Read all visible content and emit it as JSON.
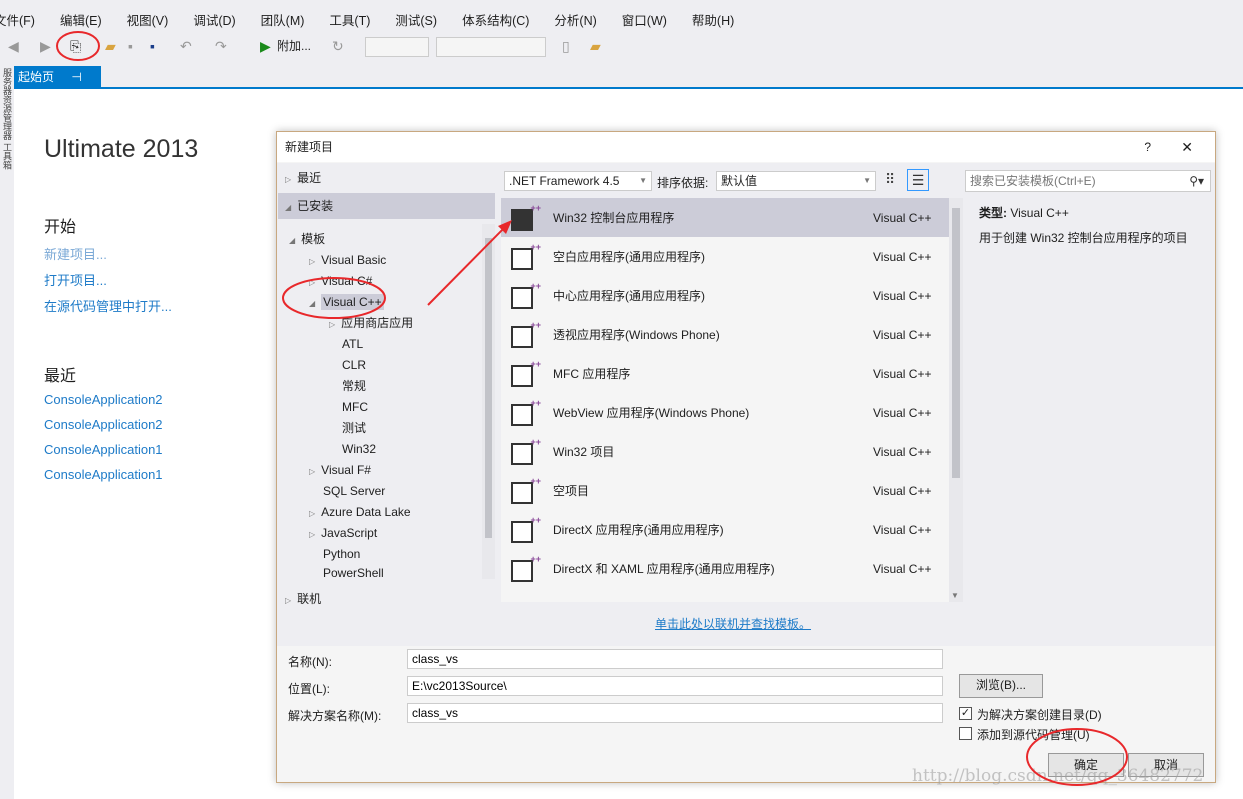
{
  "menu": [
    "文件(F)",
    "编辑(E)",
    "视图(V)",
    "调试(D)",
    "团队(M)",
    "工具(T)",
    "测试(S)",
    "体系结构(C)",
    "分析(N)",
    "窗口(W)",
    "帮助(H)"
  ],
  "toolbar": {
    "attach_label": "附加..."
  },
  "tab": {
    "label": "起始页",
    "pin": "⊣",
    "close": "✕"
  },
  "side_strip": "服务器资源管理器 工具箱",
  "start": {
    "product": "Ultimate 2013",
    "start_heading": "开始",
    "new_project": "新建项目...",
    "open_project": "打开项目...",
    "open_source": "在源代码管理中打开...",
    "recent_heading": "最近",
    "recent": [
      "ConsoleApplication2",
      "ConsoleApplication2",
      "ConsoleApplication1",
      "ConsoleApplication1"
    ]
  },
  "dialog": {
    "title": "新建项目",
    "help": "?",
    "close": "✕",
    "tree": {
      "recent": "最近",
      "installed": "已安装",
      "templates": "模板",
      "vb": "Visual Basic",
      "cs": "Visual C#",
      "cpp": "Visual C++",
      "cpp_children": [
        "应用商店应用",
        "ATL",
        "CLR",
        "常规",
        "MFC",
        "测试",
        "Win32"
      ],
      "others": [
        "Visual F#",
        "SQL Server",
        "Azure Data Lake",
        "JavaScript",
        "Python",
        "PowerShell"
      ],
      "online": "联机"
    },
    "framework": ".NET Framework 4.5",
    "sort_label": "排序依据:",
    "sort_value": "默认值",
    "search_placeholder": "搜索已安装模板(Ctrl+E)",
    "templates": [
      {
        "name": "Win32 控制台应用程序",
        "lang": "Visual C++"
      },
      {
        "name": "空白应用程序(通用应用程序)",
        "lang": "Visual C++"
      },
      {
        "name": "中心应用程序(通用应用程序)",
        "lang": "Visual C++"
      },
      {
        "name": "透视应用程序(Windows Phone)",
        "lang": "Visual C++"
      },
      {
        "name": "MFC 应用程序",
        "lang": "Visual C++"
      },
      {
        "name": "WebView 应用程序(Windows Phone)",
        "lang": "Visual C++"
      },
      {
        "name": "Win32 项目",
        "lang": "Visual C++"
      },
      {
        "name": "空项目",
        "lang": "Visual C++"
      },
      {
        "name": "DirectX 应用程序(通用应用程序)",
        "lang": "Visual C++"
      },
      {
        "name": "DirectX 和 XAML 应用程序(通用应用程序)",
        "lang": "Visual C++"
      }
    ],
    "type_label": "类型:",
    "type_value": "Visual C++",
    "description": "用于创建 Win32 控制台应用程序的项目",
    "online_link": "单击此处以联机并查找模板。",
    "name_label": "名称(N):",
    "name_value": "class_vs",
    "location_label": "位置(L):",
    "location_value": "E:\\vc2013Source\\",
    "solution_label": "解决方案名称(M):",
    "solution_value": "class_vs",
    "browse": "浏览(B)...",
    "create_dir": "为解决方案创建目录(D)",
    "create_dir_checked": true,
    "add_scc": "添加到源代码管理(U)",
    "add_scc_checked": false,
    "ok": "确定",
    "cancel": "取消"
  },
  "watermark": "http://blog.csdn.net/qq_36482772",
  "colors": {
    "accent": "#007acc",
    "annotation": "#e8282b",
    "link": "#1e7bc8"
  }
}
